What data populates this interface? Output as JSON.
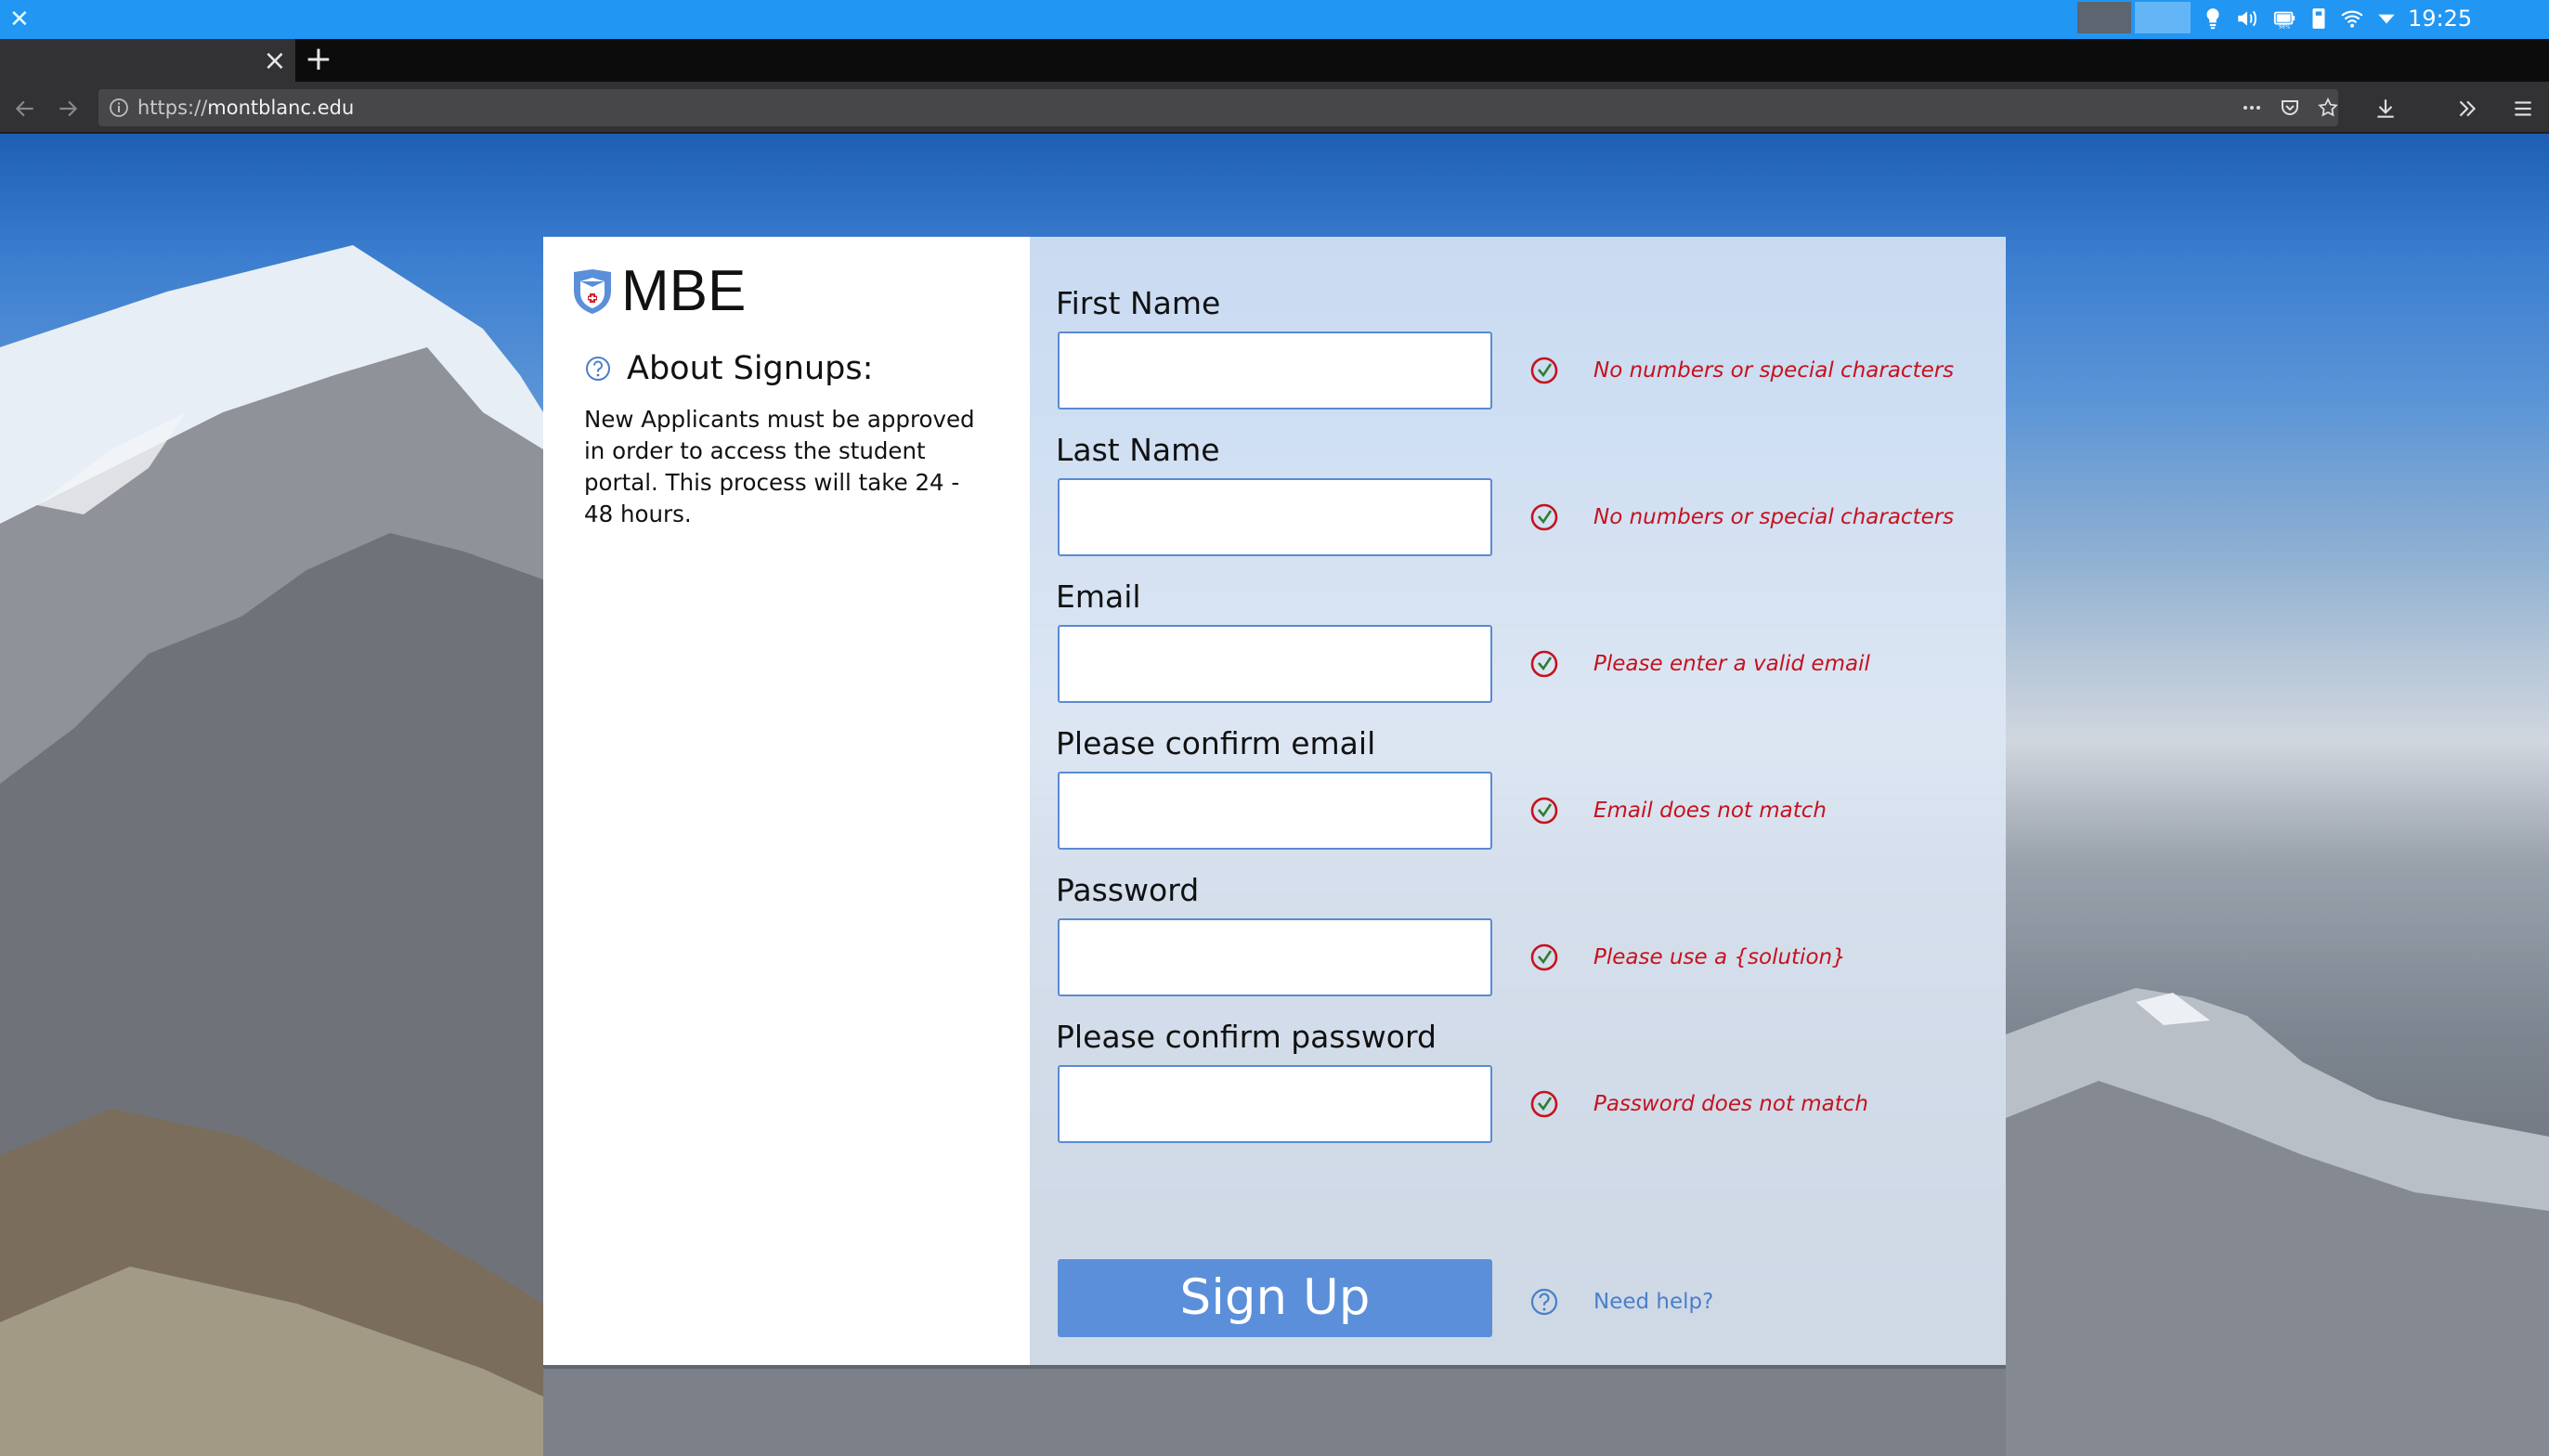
{
  "os": {
    "clock": "19:25",
    "battery_pct": "98%"
  },
  "browser": {
    "url_prefix": "https://",
    "url_host": "montblanc.edu"
  },
  "page": {
    "logo_text": "MBE",
    "about": {
      "title": "About Signups:",
      "body": "New Applicants must be approved in order to access the student portal.  This process will take 24 - 48 hours."
    },
    "fields": [
      {
        "label": "First Name",
        "value": "",
        "error": "No numbers or special characters"
      },
      {
        "label": "Last Name",
        "value": "",
        "error": "No numbers or special characters"
      },
      {
        "label": "Email",
        "value": "",
        "error": "Please enter a valid email"
      },
      {
        "label": "Please confirm email",
        "value": "",
        "error": "Email does not match"
      },
      {
        "label": "Password",
        "value": "",
        "error": "Please use a {solution}"
      },
      {
        "label": "Please confirm password",
        "value": "",
        "error": "Password does not match"
      }
    ],
    "signup_label": "Sign Up",
    "help_label": "Need help?"
  },
  "colors": {
    "os_bar": "#2196f3",
    "button": "#5b8fd9",
    "error": "#c6121d",
    "link": "#4a7fc8",
    "input_border": "#5a8ad3"
  }
}
